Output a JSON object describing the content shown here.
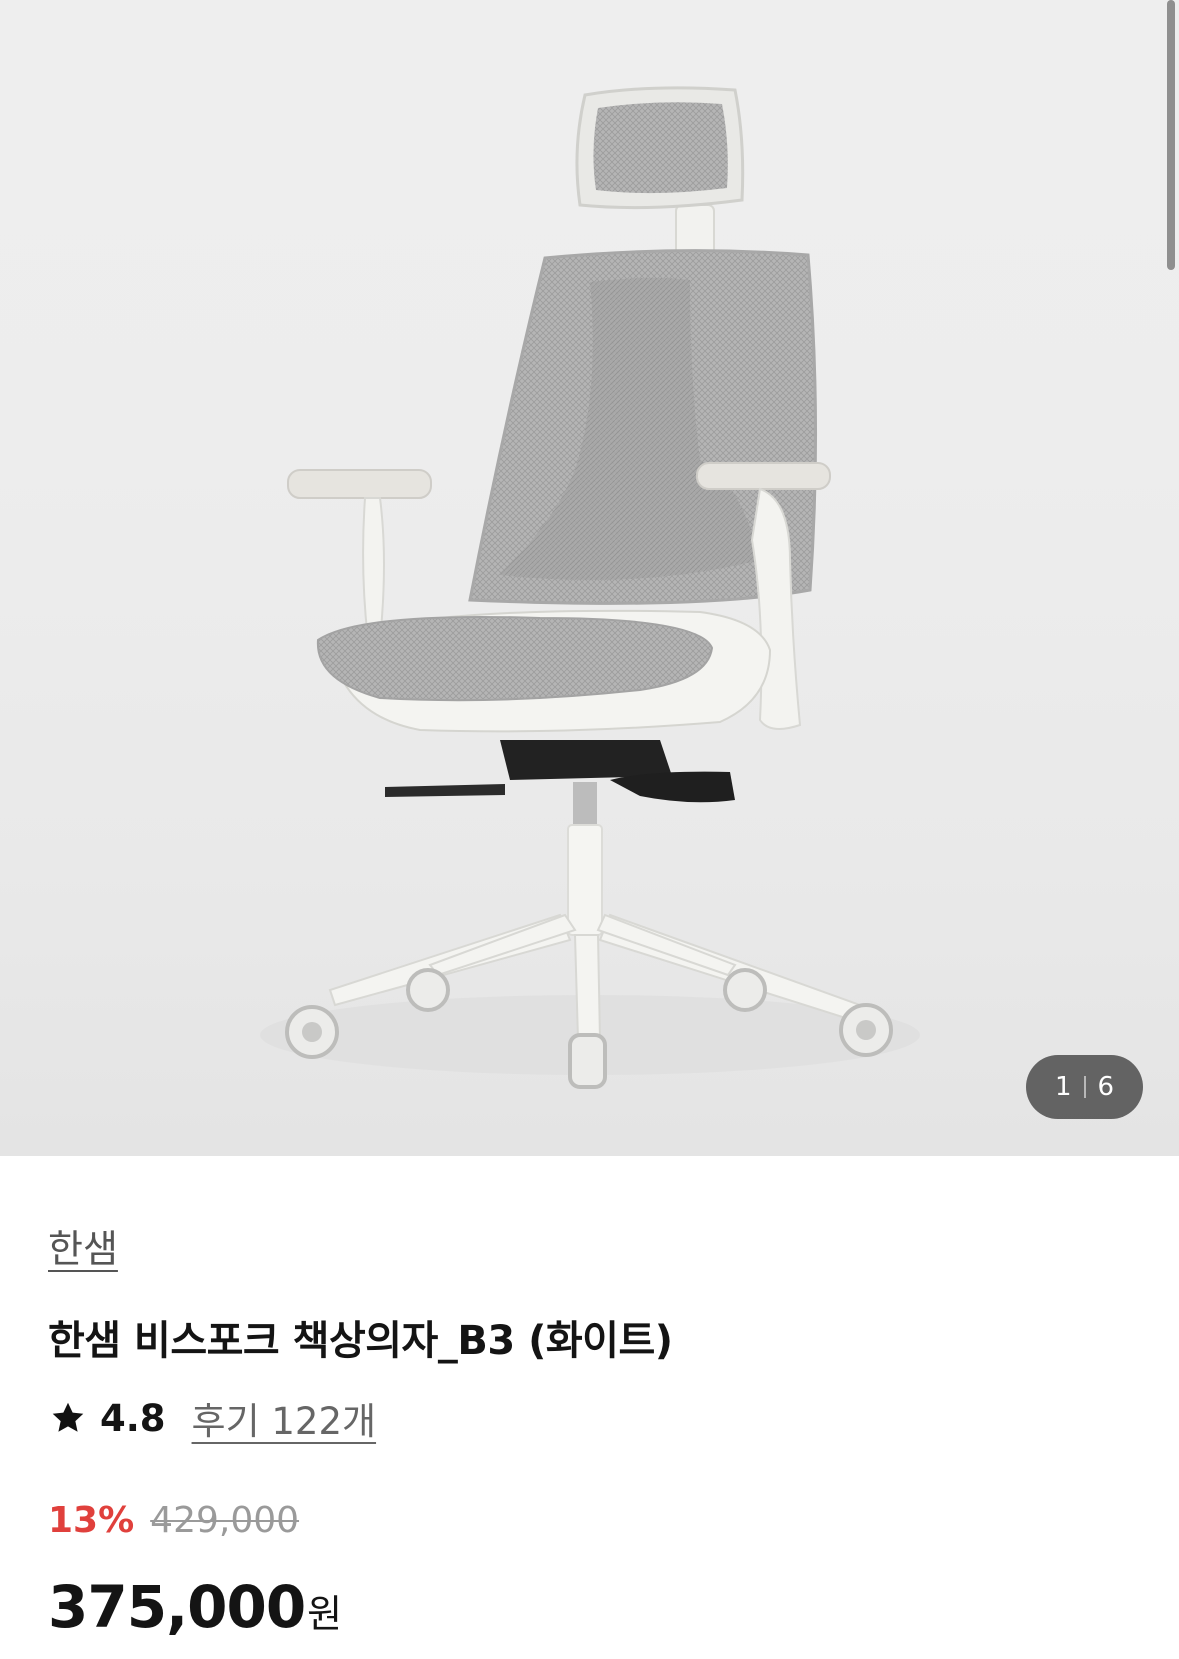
{
  "gallery": {
    "image_alt": "white mesh office chair with headrest",
    "current": "1",
    "total": "6"
  },
  "product": {
    "brand": "한샘",
    "title": "한샘 비스포크 책상의자_B3 (화이트)",
    "rating": "4.8",
    "reviews_label": "후기 122개",
    "discount_rate": "13%",
    "original_price": "429,000",
    "sale_price": "375,000",
    "currency": "원"
  },
  "colors": {
    "discount": "#e0403c",
    "text": "#141414",
    "muted": "#666666"
  },
  "icons": {
    "rating": "star-icon"
  }
}
